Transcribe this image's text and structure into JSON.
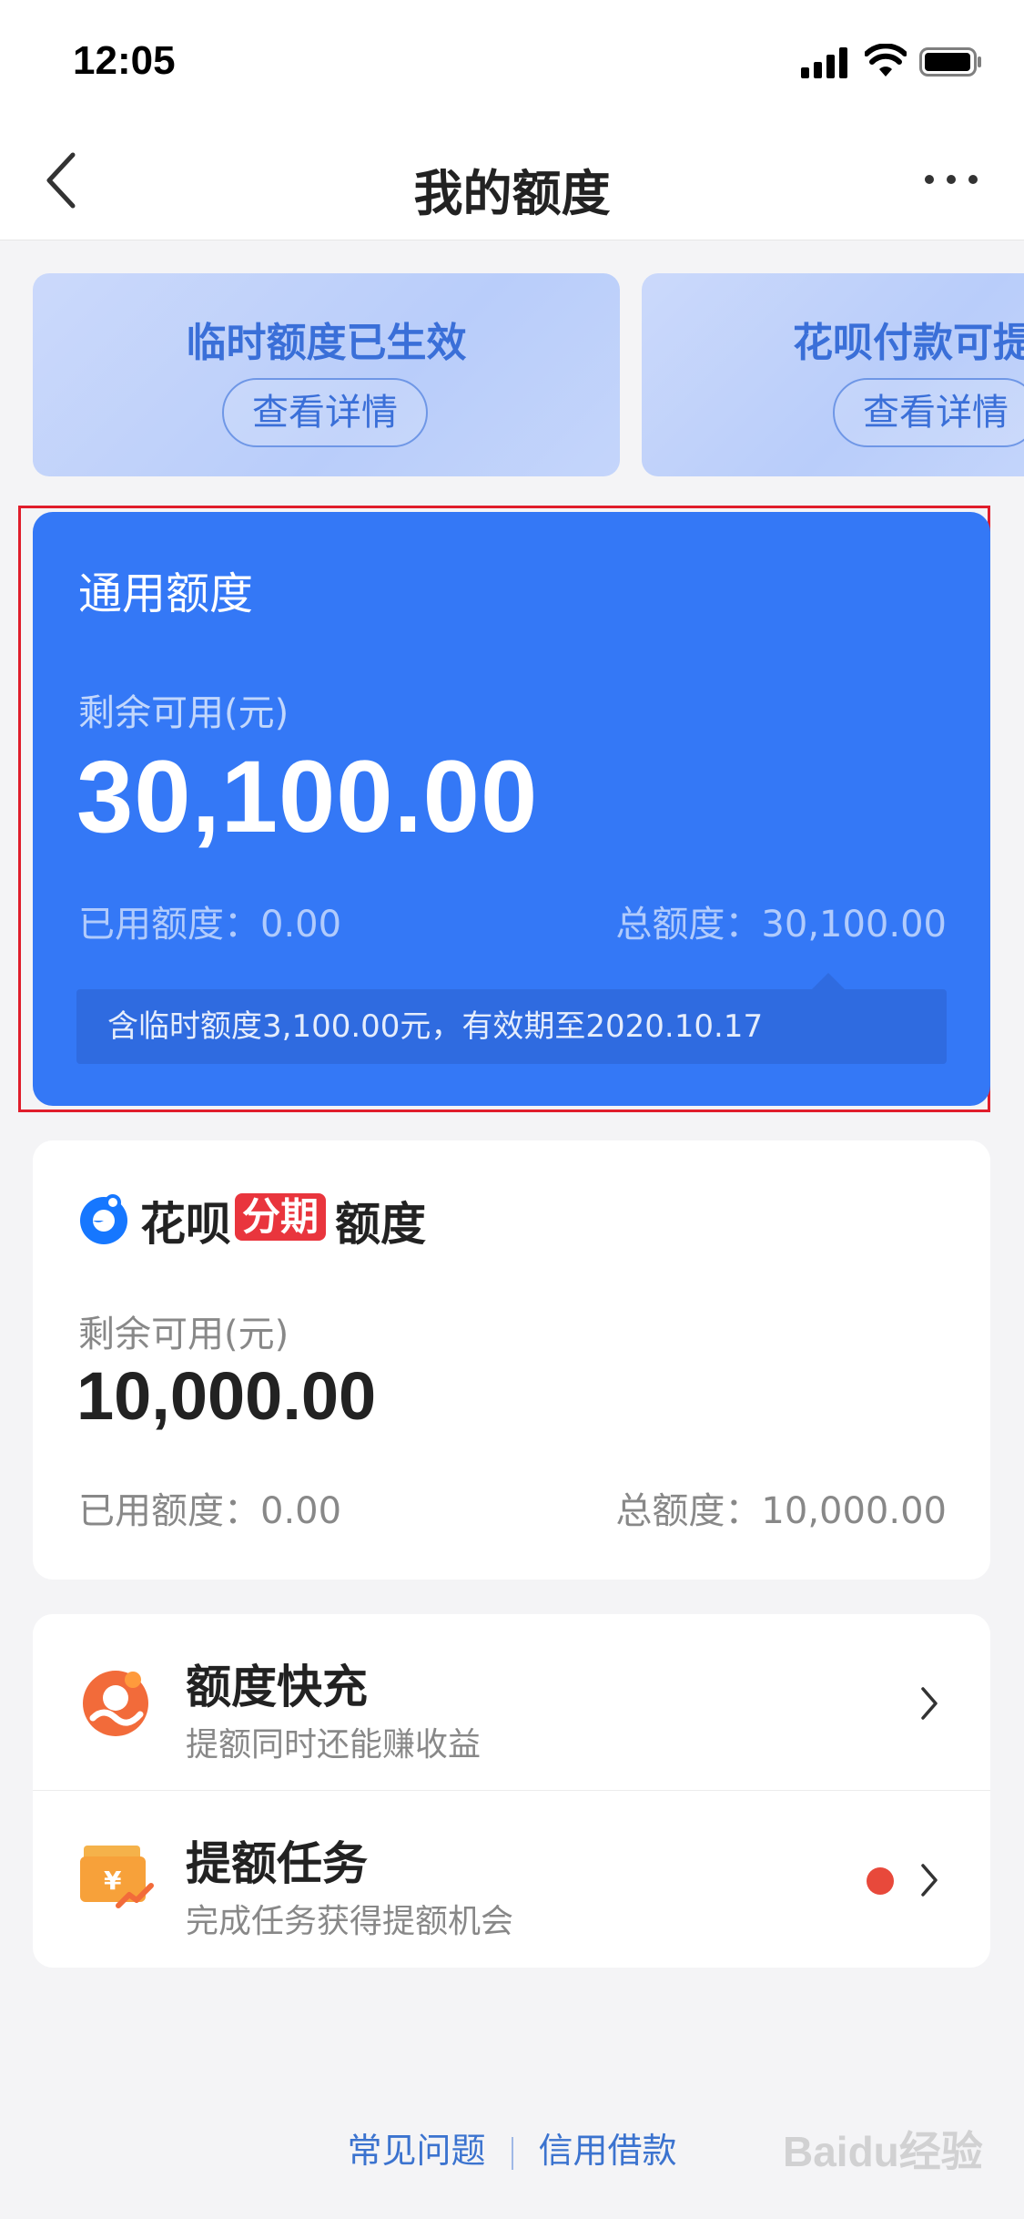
{
  "status_bar": {
    "time": "12:05"
  },
  "nav": {
    "title": "我的额度"
  },
  "banners": [
    {
      "title": "临时额度已生效",
      "button": "查看详情"
    },
    {
      "title": "花呗付款可提",
      "button": "查看详情"
    }
  ],
  "general_quota": {
    "title": "通用额度",
    "available_label": "剩余可用(元)",
    "available_amount": "30,100.00",
    "used": "已用额度：0.00",
    "total": "总额度：30,100.00",
    "tip": "含临时额度3,100.00元，有效期至2020.10.17"
  },
  "huabei_installment": {
    "brand": "花呗",
    "tag": "分期",
    "label": "额度",
    "available_label": "剩余可用(元)",
    "available_amount": "10,000.00",
    "used": "已用额度：0.00",
    "total": "总额度：10,000.00"
  },
  "list": [
    {
      "title": "额度快充",
      "desc": "提额同时还能赚收益",
      "icon": "quick-charge-icon"
    },
    {
      "title": "提额任务",
      "desc": "完成任务获得提额机会",
      "icon": "task-reward-icon",
      "badge": "red-dot"
    }
  ],
  "footer": {
    "faq": "常见问题",
    "credit_loan": "信用借款"
  },
  "watermark": "Baidu经验",
  "colors": {
    "primary_blue": "#3478f6",
    "banner_text": "#3a6fd8",
    "highlight_red": "#e01d2b",
    "tag_red": "#e9353d",
    "dot_red": "#e8493b",
    "page_bg": "#f4f4f6"
  }
}
